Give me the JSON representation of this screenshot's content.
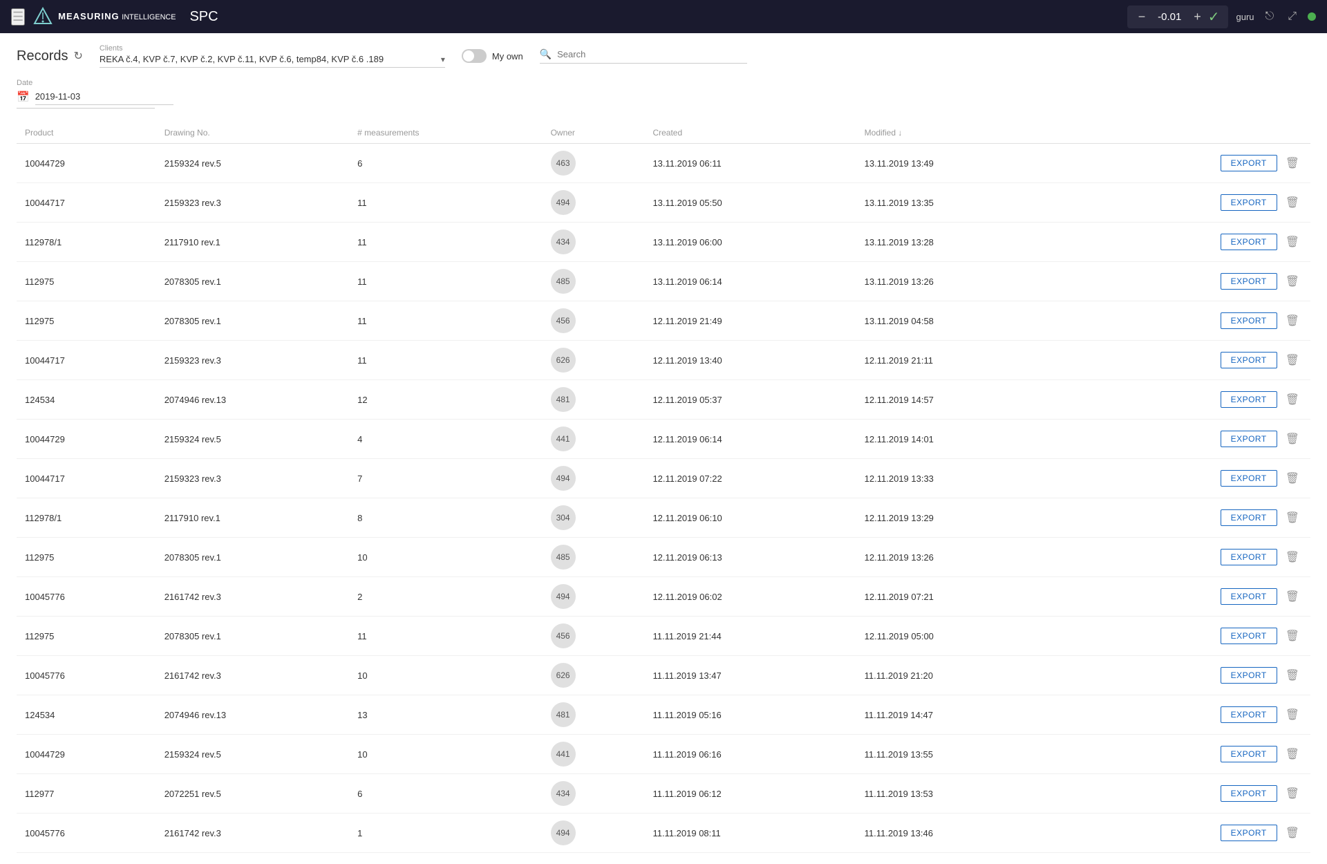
{
  "topbar": {
    "menu_icon": "☰",
    "brand_name": "MEASURING",
    "brand_sub": "INTELLIGENCE",
    "app_name": "SPC",
    "value_label": "-0.01",
    "minus_label": "−",
    "plus_label": "+",
    "check_label": "✓",
    "user_label": "guru",
    "login_icon": "⎋",
    "expand_icon": "⤢",
    "dot_color": "#4caf50"
  },
  "filters": {
    "clients_label": "Clients",
    "clients_value": "REKA č.4, KVP č.7, KVP č.2, KVP č.11, KVP č.6, temp84, KVP č.6 .189",
    "my_own_label": "My own",
    "search_placeholder": "Search"
  },
  "date_filter": {
    "label": "Date",
    "value": "2019-11-03"
  },
  "table": {
    "columns": [
      {
        "key": "product",
        "label": "Product"
      },
      {
        "key": "drawing_no",
        "label": "Drawing No."
      },
      {
        "key": "measurements",
        "label": "# measurements"
      },
      {
        "key": "owner",
        "label": "Owner"
      },
      {
        "key": "created",
        "label": "Created"
      },
      {
        "key": "modified",
        "label": "Modified ↓"
      }
    ],
    "rows": [
      {
        "product": "10044729",
        "drawing_no": "2159324 rev.5",
        "measurements": "6",
        "owner": "463",
        "created": "13.11.2019 06:11",
        "modified": "13.11.2019 13:49"
      },
      {
        "product": "10044717",
        "drawing_no": "2159323 rev.3",
        "measurements": "11",
        "owner": "494",
        "created": "13.11.2019 05:50",
        "modified": "13.11.2019 13:35"
      },
      {
        "product": "112978/1",
        "drawing_no": "2117910 rev.1",
        "measurements": "11",
        "owner": "434",
        "created": "13.11.2019 06:00",
        "modified": "13.11.2019 13:28"
      },
      {
        "product": "112975",
        "drawing_no": "2078305 rev.1",
        "measurements": "11",
        "owner": "485",
        "created": "13.11.2019 06:14",
        "modified": "13.11.2019 13:26"
      },
      {
        "product": "112975",
        "drawing_no": "2078305 rev.1",
        "measurements": "11",
        "owner": "456",
        "created": "12.11.2019 21:49",
        "modified": "13.11.2019 04:58"
      },
      {
        "product": "10044717",
        "drawing_no": "2159323 rev.3",
        "measurements": "11",
        "owner": "626",
        "created": "12.11.2019 13:40",
        "modified": "12.11.2019 21:11"
      },
      {
        "product": "124534",
        "drawing_no": "2074946 rev.13",
        "measurements": "12",
        "owner": "481",
        "created": "12.11.2019 05:37",
        "modified": "12.11.2019 14:57"
      },
      {
        "product": "10044729",
        "drawing_no": "2159324 rev.5",
        "measurements": "4",
        "owner": "441",
        "created": "12.11.2019 06:14",
        "modified": "12.11.2019 14:01"
      },
      {
        "product": "10044717",
        "drawing_no": "2159323 rev.3",
        "measurements": "7",
        "owner": "494",
        "created": "12.11.2019 07:22",
        "modified": "12.11.2019 13:33"
      },
      {
        "product": "112978/1",
        "drawing_no": "2117910 rev.1",
        "measurements": "8",
        "owner": "304",
        "created": "12.11.2019 06:10",
        "modified": "12.11.2019 13:29"
      },
      {
        "product": "112975",
        "drawing_no": "2078305 rev.1",
        "measurements": "10",
        "owner": "485",
        "created": "12.11.2019 06:13",
        "modified": "12.11.2019 13:26"
      },
      {
        "product": "10045776",
        "drawing_no": "2161742 rev.3",
        "measurements": "2",
        "owner": "494",
        "created": "12.11.2019 06:02",
        "modified": "12.11.2019 07:21"
      },
      {
        "product": "112975",
        "drawing_no": "2078305 rev.1",
        "measurements": "11",
        "owner": "456",
        "created": "11.11.2019 21:44",
        "modified": "12.11.2019 05:00"
      },
      {
        "product": "10045776",
        "drawing_no": "2161742 rev.3",
        "measurements": "10",
        "owner": "626",
        "created": "11.11.2019 13:47",
        "modified": "11.11.2019 21:20"
      },
      {
        "product": "124534",
        "drawing_no": "2074946 rev.13",
        "measurements": "13",
        "owner": "481",
        "created": "11.11.2019 05:16",
        "modified": "11.11.2019 14:47"
      },
      {
        "product": "10044729",
        "drawing_no": "2159324 rev.5",
        "measurements": "10",
        "owner": "441",
        "created": "11.11.2019 06:16",
        "modified": "11.11.2019 13:55"
      },
      {
        "product": "112977",
        "drawing_no": "2072251 rev.5",
        "measurements": "6",
        "owner": "434",
        "created": "11.11.2019 06:12",
        "modified": "11.11.2019 13:53"
      },
      {
        "product": "10045776",
        "drawing_no": "2161742 rev.3",
        "measurements": "1",
        "owner": "494",
        "created": "11.11.2019 08:11",
        "modified": "11.11.2019 13:46"
      }
    ],
    "export_label": "EXPORT"
  }
}
